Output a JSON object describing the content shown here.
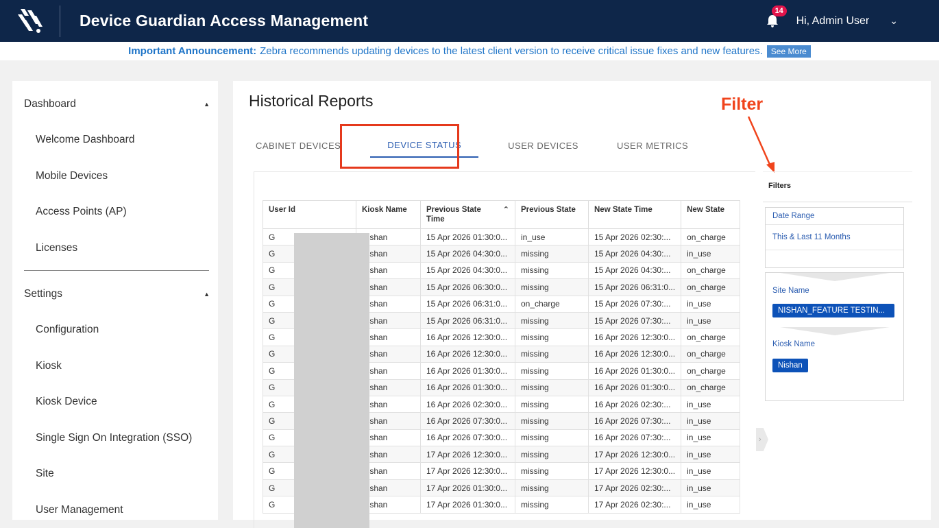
{
  "header": {
    "app_title": "Device Guardian Access Management",
    "notification_count": "14",
    "user_greeting": "Hi, Admin User"
  },
  "announcement": {
    "label": "Important Announcement:",
    "text": "Zebra recommends updating devices to the latest client version to receive critical issue fixes and new features.",
    "button": "See More"
  },
  "sidebar": {
    "sections": [
      {
        "label": "Dashboard",
        "items": [
          "Welcome Dashboard",
          "Mobile Devices",
          "Access Points (AP)",
          "Licenses"
        ]
      },
      {
        "label": "Settings",
        "items": [
          "Configuration",
          "Kiosk",
          "Kiosk Device",
          "Single Sign On Integration (SSO)",
          "Site",
          "User Management"
        ]
      }
    ]
  },
  "main": {
    "title": "Historical Reports",
    "annotation": "Filter",
    "tabs": [
      "CABINET DEVICES",
      "DEVICE STATUS",
      "USER DEVICES",
      "USER METRICS"
    ],
    "active_tab": "DEVICE STATUS"
  },
  "table": {
    "columns": [
      "User Id",
      "Kiosk Name",
      "Previous State Time",
      "Previous State",
      "New State Time",
      "New State"
    ],
    "rows": [
      [
        "G",
        "Nishan",
        "15 Apr 2026 01:30:0...",
        "in_use",
        "15 Apr 2026 02:30:...",
        "on_charge"
      ],
      [
        "G",
        "Nishan",
        "15 Apr 2026 04:30:0...",
        "missing",
        "15 Apr 2026 04:30:...",
        "in_use"
      ],
      [
        "G",
        "Nishan",
        "15 Apr 2026 04:30:0...",
        "missing",
        "15 Apr 2026 04:30:...",
        "on_charge"
      ],
      [
        "G",
        "Nishan",
        "15 Apr 2026 06:30:0...",
        "missing",
        "15 Apr 2026 06:31:0...",
        "on_charge"
      ],
      [
        "G",
        "Nishan",
        "15 Apr 2026 06:31:0...",
        "on_charge",
        "15 Apr 2026 07:30:...",
        "in_use"
      ],
      [
        "G",
        "Nishan",
        "15 Apr 2026 06:31:0...",
        "missing",
        "15 Apr 2026 07:30:...",
        "in_use"
      ],
      [
        "G",
        "Nishan",
        "16 Apr 2026 12:30:0...",
        "missing",
        "16 Apr 2026 12:30:0...",
        "on_charge"
      ],
      [
        "G",
        "Nishan",
        "16 Apr 2026 12:30:0...",
        "missing",
        "16 Apr 2026 12:30:0...",
        "on_charge"
      ],
      [
        "G",
        "Nishan",
        "16 Apr 2026 01:30:0...",
        "missing",
        "16 Apr 2026 01:30:0...",
        "on_charge"
      ],
      [
        "G",
        "Nishan",
        "16 Apr 2026 01:30:0...",
        "missing",
        "16 Apr 2026 01:30:0...",
        "on_charge"
      ],
      [
        "G",
        "Nishan",
        "16 Apr 2026 02:30:0...",
        "missing",
        "16 Apr 2026 02:30:...",
        "in_use"
      ],
      [
        "G",
        "Nishan",
        "16 Apr 2026 07:30:0...",
        "missing",
        "16 Apr 2026 07:30:...",
        "in_use"
      ],
      [
        "G",
        "Nishan",
        "16 Apr 2026 07:30:0...",
        "missing",
        "16 Apr 2026 07:30:...",
        "in_use"
      ],
      [
        "G",
        "Nishan",
        "17 Apr 2026 12:30:0...",
        "missing",
        "17 Apr 2026 12:30:0...",
        "in_use"
      ],
      [
        "G",
        "Nishan",
        "17 Apr 2026 12:30:0...",
        "missing",
        "17 Apr 2026 12:30:0...",
        "in_use"
      ],
      [
        "G",
        "Nishan",
        "17 Apr 2026 01:30:0...",
        "missing",
        "17 Apr 2026 02:30:...",
        "in_use"
      ],
      [
        "G",
        "Nishan",
        "17 Apr 2026 01:30:0...",
        "missing",
        "17 Apr 2026 02:30:...",
        "in_use"
      ]
    ]
  },
  "filters": {
    "title": "Filters",
    "date_range_label": "Date Range",
    "date_range_value": "This & Last 11 Months",
    "site_name_label": "Site Name",
    "site_name_value": "NISHAN_FEATURE TESTIN...",
    "kiosk_name_label": "Kiosk Name",
    "kiosk_name_value": "Nishan"
  },
  "colors": {
    "header_bg": "#0e2649",
    "accent": "#2a5cb0",
    "annotation": "#e5391c",
    "badge": "#e1144b"
  }
}
